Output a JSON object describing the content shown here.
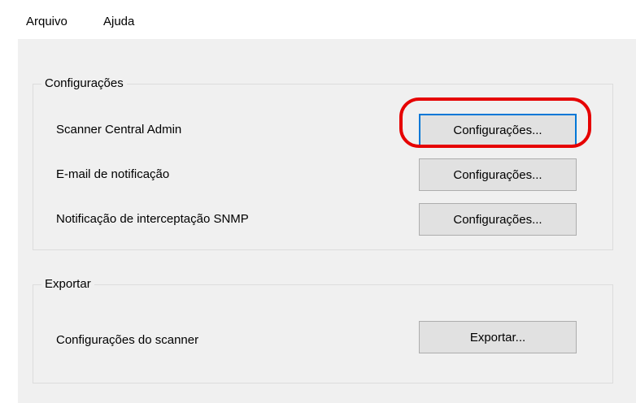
{
  "menu": {
    "items": [
      {
        "label": "Arquivo"
      },
      {
        "label": "Ajuda"
      }
    ]
  },
  "settings_group": {
    "title": "Configurações",
    "rows": [
      {
        "label": "Scanner Central Admin",
        "button": "Configurações..."
      },
      {
        "label": "E-mail de notificação",
        "button": "Configurações..."
      },
      {
        "label": "Notificação de interceptação SNMP",
        "button": "Configurações..."
      }
    ]
  },
  "export_group": {
    "title": "Exportar",
    "rows": [
      {
        "label": "Configurações do scanner",
        "button": "Exportar..."
      }
    ]
  },
  "annotation": {
    "highlight_color": "#e60000",
    "focus_color": "#0078d7"
  }
}
